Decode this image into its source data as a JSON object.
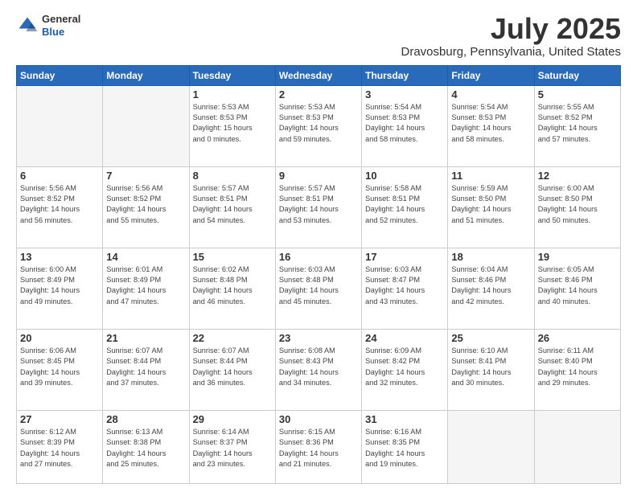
{
  "header": {
    "logo_general": "General",
    "logo_blue": "Blue",
    "month_year": "July 2025",
    "location": "Dravosburg, Pennsylvania, United States"
  },
  "days_of_week": [
    "Sunday",
    "Monday",
    "Tuesday",
    "Wednesday",
    "Thursday",
    "Friday",
    "Saturday"
  ],
  "weeks": [
    [
      {
        "day": "",
        "info": ""
      },
      {
        "day": "",
        "info": ""
      },
      {
        "day": "1",
        "info": "Sunrise: 5:53 AM\nSunset: 8:53 PM\nDaylight: 15 hours\nand 0 minutes."
      },
      {
        "day": "2",
        "info": "Sunrise: 5:53 AM\nSunset: 8:53 PM\nDaylight: 14 hours\nand 59 minutes."
      },
      {
        "day": "3",
        "info": "Sunrise: 5:54 AM\nSunset: 8:53 PM\nDaylight: 14 hours\nand 58 minutes."
      },
      {
        "day": "4",
        "info": "Sunrise: 5:54 AM\nSunset: 8:53 PM\nDaylight: 14 hours\nand 58 minutes."
      },
      {
        "day": "5",
        "info": "Sunrise: 5:55 AM\nSunset: 8:52 PM\nDaylight: 14 hours\nand 57 minutes."
      }
    ],
    [
      {
        "day": "6",
        "info": "Sunrise: 5:56 AM\nSunset: 8:52 PM\nDaylight: 14 hours\nand 56 minutes."
      },
      {
        "day": "7",
        "info": "Sunrise: 5:56 AM\nSunset: 8:52 PM\nDaylight: 14 hours\nand 55 minutes."
      },
      {
        "day": "8",
        "info": "Sunrise: 5:57 AM\nSunset: 8:51 PM\nDaylight: 14 hours\nand 54 minutes."
      },
      {
        "day": "9",
        "info": "Sunrise: 5:57 AM\nSunset: 8:51 PM\nDaylight: 14 hours\nand 53 minutes."
      },
      {
        "day": "10",
        "info": "Sunrise: 5:58 AM\nSunset: 8:51 PM\nDaylight: 14 hours\nand 52 minutes."
      },
      {
        "day": "11",
        "info": "Sunrise: 5:59 AM\nSunset: 8:50 PM\nDaylight: 14 hours\nand 51 minutes."
      },
      {
        "day": "12",
        "info": "Sunrise: 6:00 AM\nSunset: 8:50 PM\nDaylight: 14 hours\nand 50 minutes."
      }
    ],
    [
      {
        "day": "13",
        "info": "Sunrise: 6:00 AM\nSunset: 8:49 PM\nDaylight: 14 hours\nand 49 minutes."
      },
      {
        "day": "14",
        "info": "Sunrise: 6:01 AM\nSunset: 8:49 PM\nDaylight: 14 hours\nand 47 minutes."
      },
      {
        "day": "15",
        "info": "Sunrise: 6:02 AM\nSunset: 8:48 PM\nDaylight: 14 hours\nand 46 minutes."
      },
      {
        "day": "16",
        "info": "Sunrise: 6:03 AM\nSunset: 8:48 PM\nDaylight: 14 hours\nand 45 minutes."
      },
      {
        "day": "17",
        "info": "Sunrise: 6:03 AM\nSunset: 8:47 PM\nDaylight: 14 hours\nand 43 minutes."
      },
      {
        "day": "18",
        "info": "Sunrise: 6:04 AM\nSunset: 8:46 PM\nDaylight: 14 hours\nand 42 minutes."
      },
      {
        "day": "19",
        "info": "Sunrise: 6:05 AM\nSunset: 8:46 PM\nDaylight: 14 hours\nand 40 minutes."
      }
    ],
    [
      {
        "day": "20",
        "info": "Sunrise: 6:06 AM\nSunset: 8:45 PM\nDaylight: 14 hours\nand 39 minutes."
      },
      {
        "day": "21",
        "info": "Sunrise: 6:07 AM\nSunset: 8:44 PM\nDaylight: 14 hours\nand 37 minutes."
      },
      {
        "day": "22",
        "info": "Sunrise: 6:07 AM\nSunset: 8:44 PM\nDaylight: 14 hours\nand 36 minutes."
      },
      {
        "day": "23",
        "info": "Sunrise: 6:08 AM\nSunset: 8:43 PM\nDaylight: 14 hours\nand 34 minutes."
      },
      {
        "day": "24",
        "info": "Sunrise: 6:09 AM\nSunset: 8:42 PM\nDaylight: 14 hours\nand 32 minutes."
      },
      {
        "day": "25",
        "info": "Sunrise: 6:10 AM\nSunset: 8:41 PM\nDaylight: 14 hours\nand 30 minutes."
      },
      {
        "day": "26",
        "info": "Sunrise: 6:11 AM\nSunset: 8:40 PM\nDaylight: 14 hours\nand 29 minutes."
      }
    ],
    [
      {
        "day": "27",
        "info": "Sunrise: 6:12 AM\nSunset: 8:39 PM\nDaylight: 14 hours\nand 27 minutes."
      },
      {
        "day": "28",
        "info": "Sunrise: 6:13 AM\nSunset: 8:38 PM\nDaylight: 14 hours\nand 25 minutes."
      },
      {
        "day": "29",
        "info": "Sunrise: 6:14 AM\nSunset: 8:37 PM\nDaylight: 14 hours\nand 23 minutes."
      },
      {
        "day": "30",
        "info": "Sunrise: 6:15 AM\nSunset: 8:36 PM\nDaylight: 14 hours\nand 21 minutes."
      },
      {
        "day": "31",
        "info": "Sunrise: 6:16 AM\nSunset: 8:35 PM\nDaylight: 14 hours\nand 19 minutes."
      },
      {
        "day": "",
        "info": ""
      },
      {
        "day": "",
        "info": ""
      }
    ]
  ]
}
